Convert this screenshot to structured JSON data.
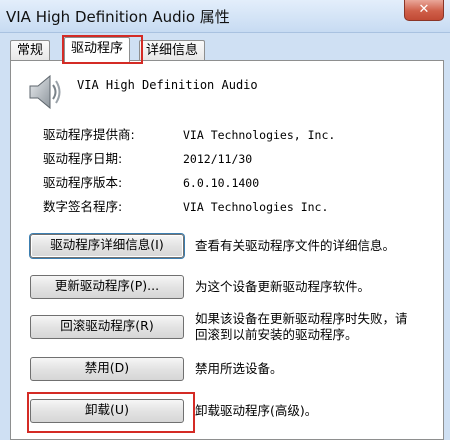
{
  "window": {
    "title": "VIA High Definition Audio 属性",
    "close_glyph": "✕"
  },
  "tabs": [
    {
      "label": "常规",
      "active": false
    },
    {
      "label": "驱动程序",
      "active": true
    },
    {
      "label": "详细信息",
      "active": false
    }
  ],
  "device": {
    "name": "VIA High Definition Audio",
    "icon": "speaker-icon"
  },
  "info": [
    {
      "label": "驱动程序提供商:",
      "value": "VIA Technologies, Inc."
    },
    {
      "label": "驱动程序日期:",
      "value": "2012/11/30"
    },
    {
      "label": "驱动程序版本:",
      "value": "6.0.10.1400"
    },
    {
      "label": "数字签名程序:",
      "value": "VIA Technologies Inc."
    }
  ],
  "actions": [
    {
      "label": "驱动程序详细信息(I)",
      "description": "查看有关驱动程序文件的详细信息。"
    },
    {
      "label": "更新驱动程序(P)...",
      "description": "为这个设备更新驱动程序软件。"
    },
    {
      "label": "回滚驱动程序(R)",
      "description_line1": "如果该设备在更新驱动程序时失败，请",
      "description_line2": "回滚到以前安装的驱动程序。"
    },
    {
      "label": "禁用(D)",
      "description": "禁用所选设备。"
    },
    {
      "label": "卸载(U)",
      "description": "卸载驱动程序(高级)。"
    }
  ],
  "colors": {
    "highlight": "#d42b25",
    "titlebar": "#cfe0f3",
    "panel": "#ffffff"
  }
}
